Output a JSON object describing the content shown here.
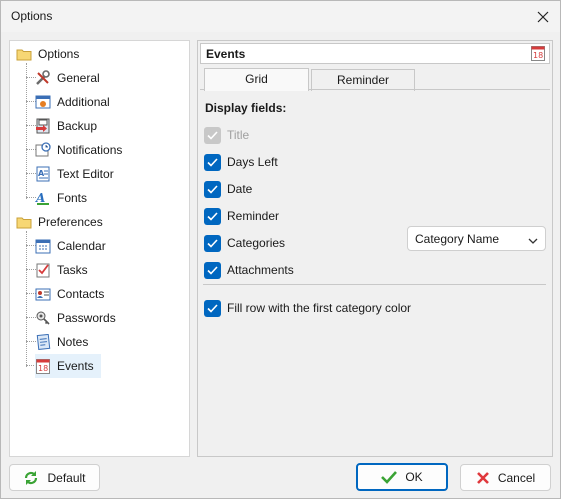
{
  "window": {
    "title": "Options"
  },
  "tree": {
    "groups": [
      {
        "label": "Options",
        "children": [
          "General",
          "Additional",
          "Backup",
          "Notifications",
          "Text Editor",
          "Fonts"
        ]
      },
      {
        "label": "Preferences",
        "children": [
          "Calendar",
          "Tasks",
          "Contacts",
          "Passwords",
          "Notes",
          "Events"
        ]
      }
    ],
    "selected": "Events"
  },
  "panel": {
    "title": "Events",
    "tabs": [
      "Grid",
      "Reminder"
    ],
    "active_tab": "Grid",
    "section_label": "Display fields:",
    "fields": [
      {
        "label": "Title",
        "checked": true,
        "disabled": true
      },
      {
        "label": "Days Left",
        "checked": true,
        "disabled": false
      },
      {
        "label": "Date",
        "checked": true,
        "disabled": false
      },
      {
        "label": "Reminder",
        "checked": true,
        "disabled": false
      },
      {
        "label": "Categories",
        "checked": true,
        "disabled": false
      },
      {
        "label": "Attachments",
        "checked": true,
        "disabled": false
      }
    ],
    "category_dropdown": {
      "value": "Category Name"
    },
    "fill_row": {
      "label": "Fill row with the first category color",
      "checked": true
    }
  },
  "buttons": {
    "default": "Default",
    "ok": "OK",
    "cancel": "Cancel"
  },
  "colors": {
    "accent": "#0067c0",
    "ok_check": "#3aa335",
    "cancel_x": "#e0383c"
  }
}
